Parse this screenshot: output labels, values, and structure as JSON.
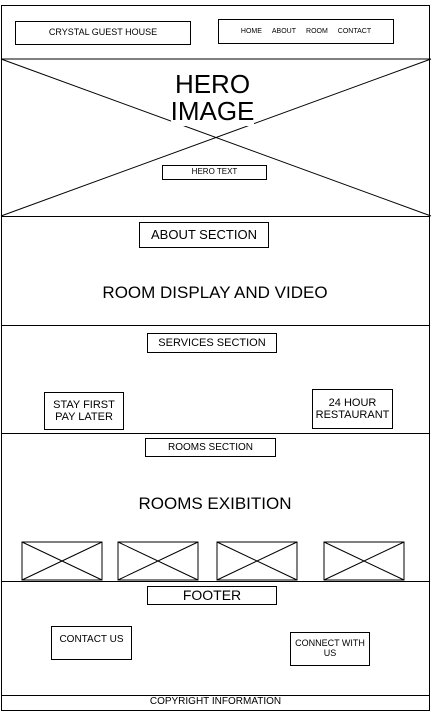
{
  "header": {
    "logo": "CRYSTAL GUEST HOUSE",
    "nav": [
      "HOME",
      "ABOUT",
      "ROOM",
      "CONTACT"
    ]
  },
  "hero": {
    "title_line1": "HERO",
    "title_line2": "IMAGE",
    "hero_text": "HERO TEXT"
  },
  "about": {
    "label": "ABOUT SECTION",
    "room_display": "ROOM DISPLAY AND VIDEO"
  },
  "services": {
    "label": "SERVICES SECTION",
    "item1_line1": "STAY FIRST",
    "item1_line2": "PAY LATER",
    "item2_line1": "24 HOUR",
    "item2_line2": "RESTAURANT"
  },
  "rooms": {
    "label": "ROOMS SECTION",
    "exhibition": "ROOMS EXIBITION"
  },
  "footer": {
    "label": "FOOTER",
    "contact": "CONTACT US",
    "connect_line1": "CONNECT WITH",
    "connect_line2": "US",
    "copyright": "COPYRIGHT INFORMATION"
  }
}
